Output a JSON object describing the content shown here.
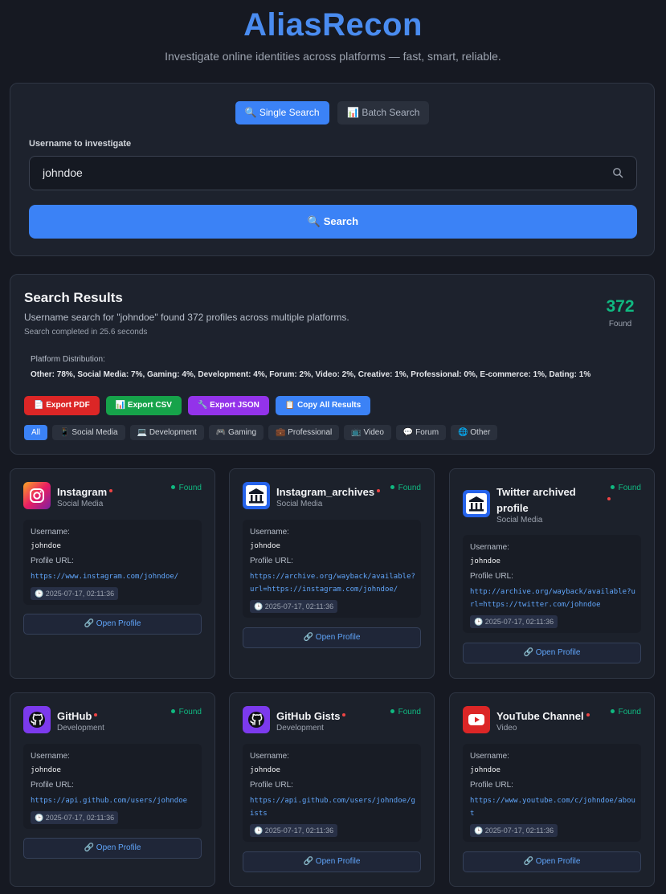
{
  "app": {
    "brand": "AliasRecon",
    "tagline": "Investigate online identities across platforms — fast, smart, reliable."
  },
  "search": {
    "tabs": [
      "🔍 Single Search",
      "📊 Batch Search"
    ],
    "field_label": "Username to investigate",
    "value": "johndoe",
    "button": "🔍 Search"
  },
  "results": {
    "title": "Search Results",
    "summary": "Username search for \"johndoe\" found 372 profiles across multiple platforms.",
    "time": "Search completed in 25.6 seconds",
    "count": "372",
    "count_label": "Found",
    "distribution_label": "Platform Distribution:",
    "distribution": "Other: 78%, Social Media: 7%, Gaming: 4%, Development: 4%, Forum: 2%, Video: 2%, Creative: 1%, Professional: 0%, E-commerce: 1%, Dating: 1%",
    "export_buttons": [
      "📄 Export PDF",
      "📊 Export CSV",
      "🔧 Export JSON",
      "📋 Copy All Results"
    ],
    "export_colors": [
      "#dc2626",
      "#16a34a",
      "#9333ea",
      "#3b82f6"
    ],
    "filters": [
      "All",
      "📱 Social Media",
      "💻 Development",
      "🎮 Gaming",
      "💼 Professional",
      "📺 Video",
      "💬 Forum",
      "🌐 Other"
    ]
  },
  "card_labels": {
    "status": "Found",
    "username_label": "Username:",
    "url_label": "Profile URL:",
    "open": "🔗 Open Profile"
  },
  "cards": [
    {
      "name": "Instagram",
      "category": "Social Media",
      "username": "johndoe",
      "url": "https://www.instagram.com/johndoe/",
      "timestamp": "🕒 2025-07-17, 02:11:36",
      "icon": "instagram-logo"
    },
    {
      "name": "Instagram_archives",
      "category": "Social Media",
      "username": "johndoe",
      "url": "https://archive.org/wayback/available?url=https://instagram.com/johndoe/",
      "timestamp": "🕒 2025-07-17, 02:11:36",
      "icon": "archive-logo"
    },
    {
      "name": "Twitter archived profile",
      "category": "Social Media",
      "username": "johndoe",
      "url": "http://archive.org/wayback/available?url=https://twitter.com/johndoe",
      "timestamp": "🕒 2025-07-17, 02:11:36",
      "icon": "archive-logo"
    },
    {
      "name": "GitHub",
      "category": "Development",
      "username": "johndoe",
      "url": "https://api.github.com/users/johndoe",
      "timestamp": "🕒 2025-07-17, 02:11:36",
      "icon": "github-logo"
    },
    {
      "name": "GitHub Gists",
      "category": "Development",
      "username": "johndoe",
      "url": "https://api.github.com/users/johndoe/gists",
      "timestamp": "🕒 2025-07-17, 02:11:36",
      "icon": "github-logo"
    },
    {
      "name": "YouTube Channel",
      "category": "Video",
      "username": "johndoe",
      "url": "https://www.youtube.com/c/johndoe/about",
      "timestamp": "🕒 2025-07-17, 02:11:36",
      "icon": "youtube-logo"
    }
  ]
}
